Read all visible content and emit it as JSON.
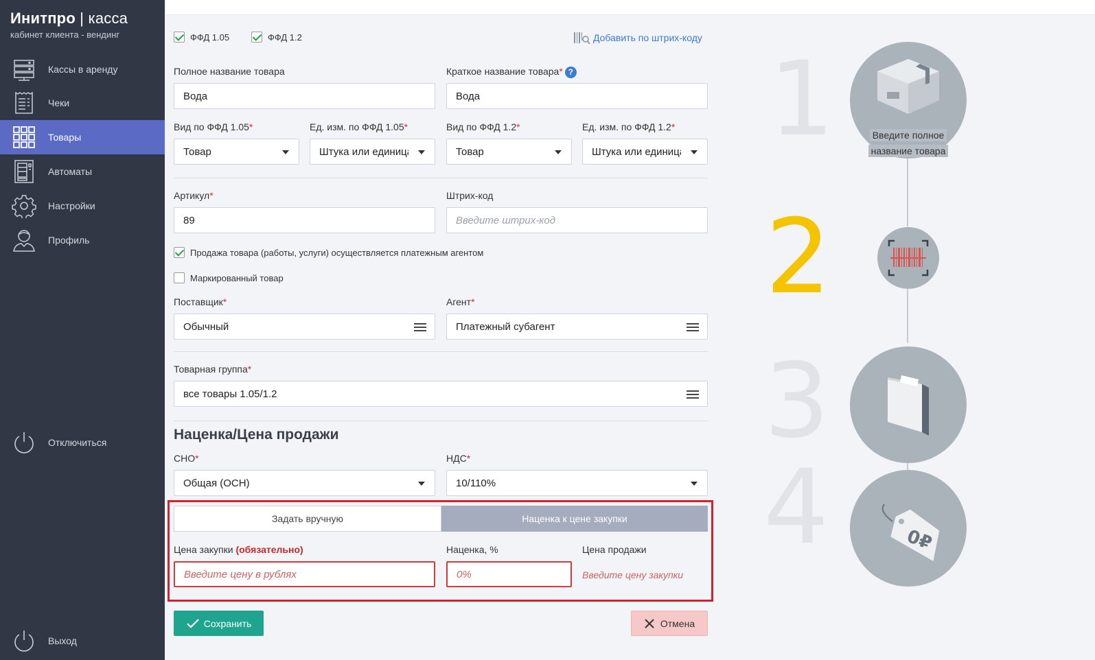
{
  "brand": {
    "name_bold": "Инитпро",
    "sep": " | ",
    "name_light": "касса",
    "subtitle": "кабинет клиента - вендинг"
  },
  "nav": [
    {
      "label": "Кассы в аренду",
      "icon": "server-icon"
    },
    {
      "label": "Чеки",
      "icon": "receipt-icon"
    },
    {
      "label": "Товары",
      "icon": "grid-icon"
    },
    {
      "label": "Автоматы",
      "icon": "vending-machine-icon"
    },
    {
      "label": "Настройки",
      "icon": "gear-icon"
    },
    {
      "label": "Профиль",
      "icon": "user-icon"
    },
    {
      "label": "Отключиться",
      "icon": "power-icon"
    },
    {
      "label": "Выход",
      "icon": "power-icon"
    }
  ],
  "form": {
    "ffd105": "ФФД 1.05",
    "ffd12": "ФФД 1.2",
    "add_by_barcode": "Добавить по штрих-коду",
    "full_name_label": "Полное название товара",
    "full_name_value": "Вода",
    "short_name_label": "Краткое название товара",
    "short_name_value": "Вода",
    "help": "?",
    "req": "*",
    "kind105_label": "Вид по ФФД 1.05",
    "kind105_value": "Товар",
    "unit105_label": "Ед. изм. по ФФД 1.05",
    "unit105_value": "Штука или единица",
    "kind12_label": "Вид по ФФД 1.2",
    "kind12_value": "Товар",
    "unit12_label": "Ед. изм. по ФФД 1.2",
    "unit12_value": "Штука или единица",
    "article_label": "Артикул",
    "article_value": "89",
    "barcode_label": "Штрих-код",
    "barcode_placeholder": "Введите штрих-код",
    "agent_sale": "Продажа товара (работы, услуги) осуществляется платежным агентом",
    "marked": "Маркированный товар",
    "supplier_label": "Поставщик",
    "supplier_value": "Обычный",
    "agent_label": "Агент",
    "agent_value": "Платежный субагент",
    "group_label": "Товарная группа",
    "group_value": "все товары 1.05/1.2",
    "price_section": "Наценка/Цена продажи",
    "sno_label": "СНО",
    "sno_value": "Общая (ОСН)",
    "nds_label": "НДС",
    "nds_value": "10/110%",
    "tab_manual": "Задать вручную",
    "tab_markup": "Наценка к цене закупки",
    "purchase_label": "Цена закупки",
    "purchase_required": "(обязательно)",
    "purchase_placeholder": "Введите цену в рублях",
    "markup_label": "Наценка, %",
    "markup_placeholder": "0%",
    "sale_label": "Цена продажи",
    "sale_hint": "Введите цену закупки",
    "save": "Сохранить",
    "cancel": "Отмена"
  },
  "steps": {
    "n1": "1",
    "n2": "2",
    "n3": "3",
    "n4": "4",
    "caption1": "Введите полное",
    "caption2": "название товара",
    "step2_color": "#f5c400"
  }
}
